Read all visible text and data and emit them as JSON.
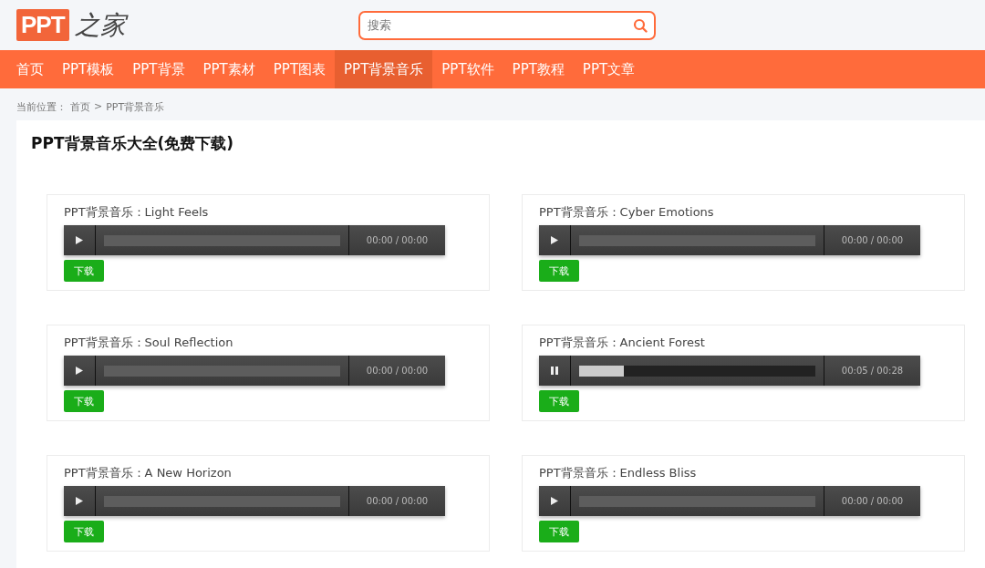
{
  "logo": {
    "mark": "PPT",
    "text": "之家"
  },
  "search": {
    "placeholder": "搜索"
  },
  "nav": [
    {
      "label": "首页",
      "selected": false
    },
    {
      "label": "PPT模板",
      "selected": false
    },
    {
      "label": "PPT背景",
      "selected": false
    },
    {
      "label": "PPT素材",
      "selected": false
    },
    {
      "label": "PPT图表",
      "selected": false
    },
    {
      "label": "PPT背景音乐",
      "selected": true
    },
    {
      "label": "PPT软件",
      "selected": false
    },
    {
      "label": "PPT教程",
      "selected": false
    },
    {
      "label": "PPT文章",
      "selected": false
    }
  ],
  "breadcrumb": {
    "prefix": "当前位置：",
    "items": [
      "首页",
      "PPT背景音乐"
    ],
    "separator": ">"
  },
  "page_title": "PPT背景音乐大全(免费下载)",
  "tracks": [
    {
      "title": "PPT背景音乐：Light Feels",
      "playing": false,
      "time": "00:00 / 00:00",
      "button": "下载"
    },
    {
      "title": "PPT背景音乐：Cyber Emotions",
      "playing": false,
      "time": "00:00 / 00:00",
      "button": "下载"
    },
    {
      "title": "PPT背景音乐：Soul Reflection",
      "playing": false,
      "time": "00:00 / 00:00",
      "button": "下载"
    },
    {
      "title": "PPT背景音乐：Ancient Forest",
      "playing": true,
      "level": 0.19,
      "time": "00:05 / 00:28",
      "button": "下载"
    },
    {
      "title": "PPT背景音乐：A New Horizon",
      "playing": false,
      "time": "00:00 / 00:00",
      "button": "下载"
    },
    {
      "title": "PPT背景音乐：Endless Bliss",
      "playing": false,
      "time": "00:00 / 00:00",
      "button": "下载"
    }
  ]
}
